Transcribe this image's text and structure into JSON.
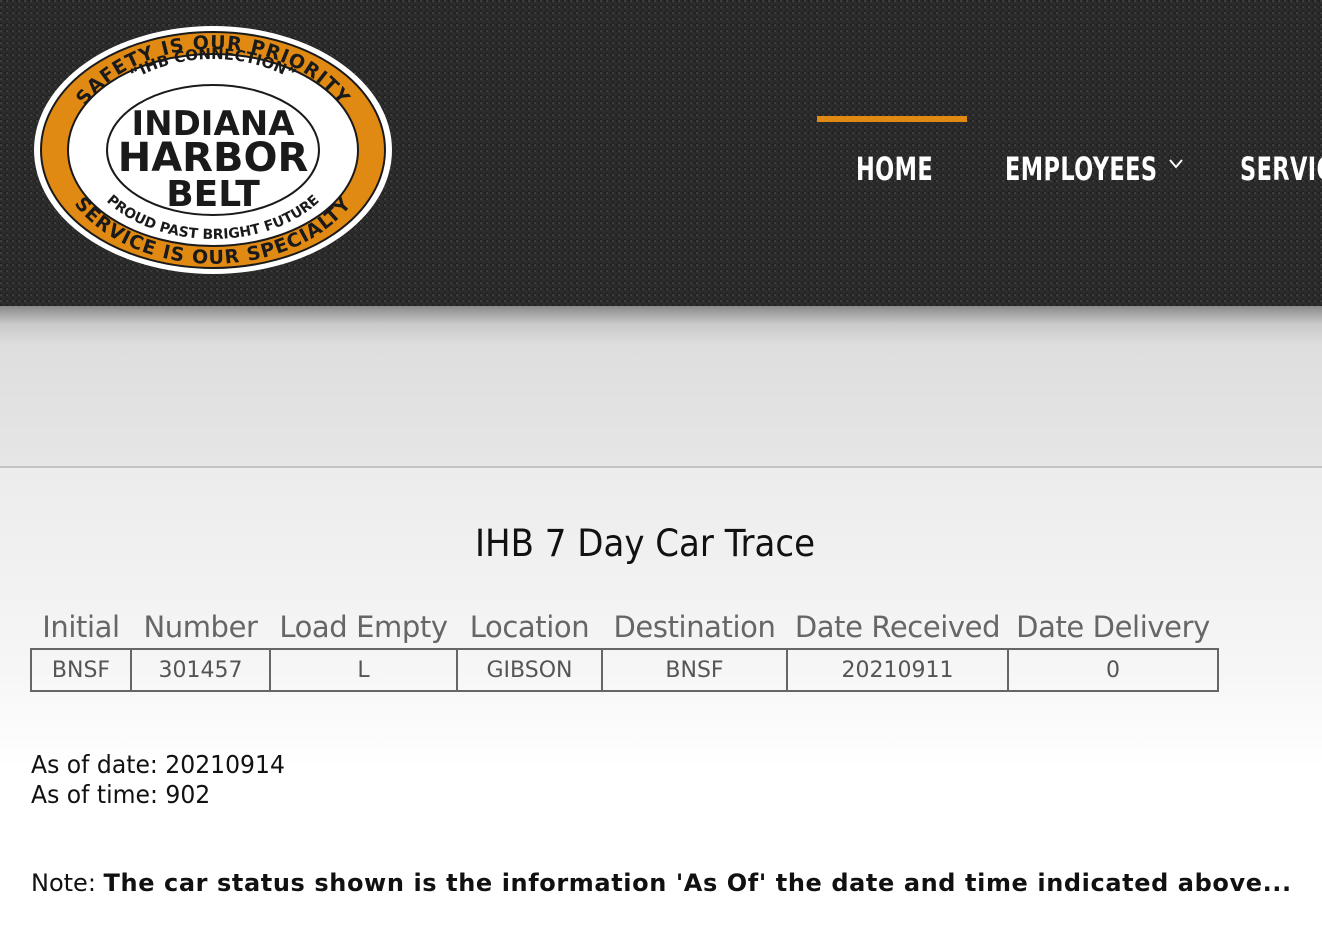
{
  "logo": {
    "top_arc": "SAFETY IS OUR PRIORITY",
    "inner_top_arc": "“IHB CONNECTION”",
    "line1": "INDIANA",
    "line2": "HARBOR",
    "line3": "BELT",
    "inner_bottom_arc": "PROUD PAST BRIGHT FUTURE",
    "bottom_arc": "SERVICE IS OUR SPECIALTY"
  },
  "nav": {
    "items": [
      {
        "label": "HOME",
        "active": true
      },
      {
        "label": "EMPLOYEES",
        "has_dropdown": true
      },
      {
        "label": "SERVIC"
      }
    ],
    "active_color": "#e08a14"
  },
  "trace": {
    "title": "IHB 7 Day Car Trace",
    "columns": [
      "Initial",
      "Number",
      "Load Empty",
      "Location",
      "Destination",
      "Date Received",
      "Date Delivery"
    ],
    "rows": [
      [
        "BNSF",
        "301457",
        "L",
        "GIBSON",
        "BNSF",
        "20210911",
        "0"
      ]
    ]
  },
  "as_of": {
    "date_label": "As of date:",
    "date_value": "20210914",
    "time_label": "As of time:",
    "time_value": "902"
  },
  "note": {
    "label": "Note:",
    "text": "The car status shown is the information 'As Of' the date and time indicated above..."
  }
}
